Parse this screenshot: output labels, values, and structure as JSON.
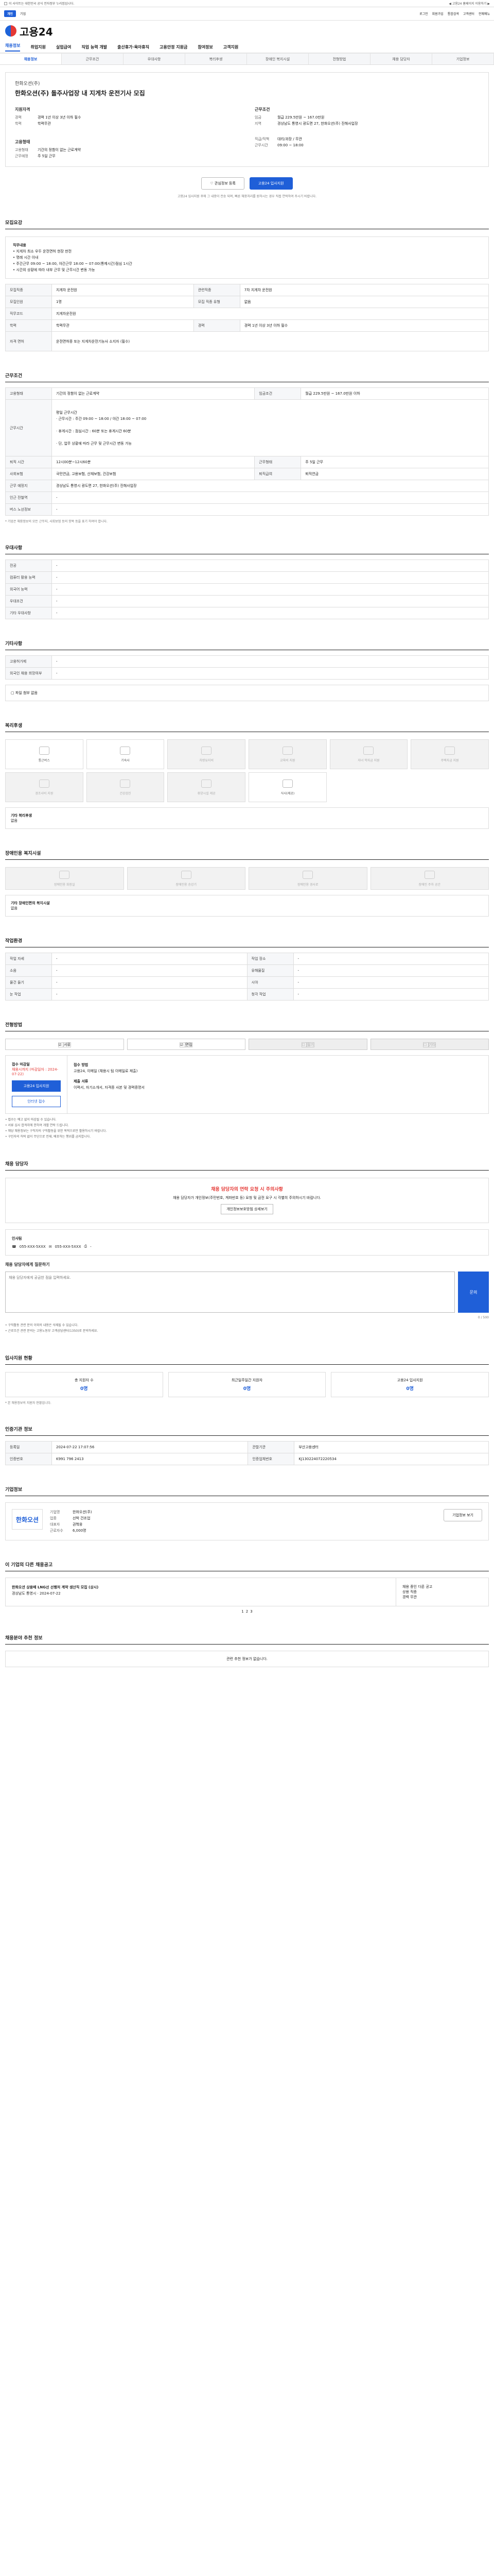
{
  "topbar": {
    "noti": "이 사이트는 대한민국 공식 전자정부 누리집입니다.",
    "right": "◀ 고용24 홈페이지 이용하기 ▶"
  },
  "topnav": {
    "left": [
      "개인",
      "기업"
    ],
    "right": [
      "로그인",
      "회원가입",
      "통합검색",
      "고객센터",
      "전체메뉴"
    ]
  },
  "logo": "고용24",
  "gnb": [
    "채용정보",
    "취업지원",
    "실업급여",
    "직업 능력 개발",
    "출산휴가·육아휴직",
    "고용안정 지원금",
    "참여정보",
    "고객지원"
  ],
  "subtabs": [
    "채용정보",
    "근무조건",
    "우대사항",
    "복리후생",
    "장애인 복지시설",
    "전형방법",
    "채용 담당자",
    "기업정보"
  ],
  "header": {
    "company": "한화오션(주)",
    "title": "한화오션(주) 돌주사업장 내 지게차 운전기사 모집",
    "left": {
      "h1": "지원자격",
      "r1": [
        [
          "경력",
          "경력 1년 이상 3년 이하 필수"
        ],
        [
          "학력",
          "학력무관"
        ]
      ],
      "h2": "고용형태",
      "r2": [
        [
          "고용형태",
          "기간의 정함이 없는 근로계약"
        ],
        [
          "근무예정",
          "주 5일 근무"
        ]
      ]
    },
    "right": {
      "h1": "근무조건",
      "r1": [
        [
          "임금",
          "월급 229.5만원 ~ 167.0만원"
        ],
        [
          "지역",
          "경상남도 통영시 광도면 27, 한화오션(주) 진해사업장"
        ]
      ],
      "r2": [
        [
          "직급/직책",
          "대리/과장",
          "무관"
        ],
        [
          "근무시간",
          "09:00 ~ 18:00"
        ]
      ]
    }
  },
  "actions": {
    "scrap": "관심정보 등록",
    "apply": "고용24 입사지원"
  },
  "actions_note": "고용24 입사지원 후에 그 내용이 전송 되며, 빠른 채용처리를 원하시는 경우 직접 연락하여 주시기 바랍니다.",
  "recruit": {
    "title": "모집요강",
    "jobtitle": "직무내용",
    "duties": [
      "지게차 최소 우두 운전면허 현장 판전",
      "명례 시간 이내",
      "주간근무 09:00 ~ 18:00, 야간근무 18:00 ~ 07:00(통제시간)점심 1시간",
      "시간외 상황에 따라 내부 근무 및 근무시간 변동 가능"
    ],
    "rows": [
      [
        "모집직종",
        "지게차 운전원",
        "관련직종",
        "7차 지게차 운전원"
      ],
      [
        "모집인원",
        "1명",
        "모집 직종 유형",
        "없음"
      ],
      [
        "직무코드",
        "지게차운전원",
        null,
        null
      ],
      [
        "학력",
        "학력무관",
        "경력",
        "경력 1년 이상 3년 이하 필수"
      ],
      [
        "자격 면허",
        "운전면허증 또는 지게차운전기능사 소지자 (필수)",
        null,
        null
      ]
    ]
  },
  "work": {
    "title": "근무조건",
    "rows": [
      [
        "고용형태",
        "기간의 정함이 없는 근로계약",
        "임금조건",
        "월급 229.5만원 ~ 167.0만원 이하"
      ],
      [
        "근무시간",
        "평일 근무시간\n· 근무시간 : 주간 09:00 ~ 18:00 / 야간 18:00 ~ 07:00\n\n· 휴게시간 : 점심시간 : 60분 또는 휴게시간 60분\n\n· 단, 업무 상황에 따라 근무 및 근무시간 변동 가능",
        null,
        null
      ],
      [
        "퇴직 시간",
        "12시00분~12시60분",
        "근무형태",
        "주 5일 근무"
      ],
      [
        "사회보험",
        "국민연금, 고용보험, 산재보험, 건강보험",
        "퇴직급여",
        "퇴직연금"
      ],
      [
        "근무 예정지",
        "경상남도 통영시 광도면 27, 한화오션(주) 진해사업장",
        null,
        null
      ],
      [
        "인근 전철역",
        "-",
        null,
        null
      ],
      [
        "버스 노선정보",
        "-",
        null,
        null
      ]
    ],
    "note": "* 기업은 채용정보의 모든 근무지, 사회보험 등의 항목 등을 표기 하여야 합니다."
  },
  "prefer": {
    "title": "우대사항",
    "rows": [
      [
        "전공",
        "-"
      ],
      [
        "컴퓨터 활용 능력",
        "-"
      ],
      [
        "외국어 능력",
        "-"
      ],
      [
        "우대조건",
        "-"
      ],
      [
        "기타 우대사항",
        "-"
      ]
    ]
  },
  "other_cond": {
    "title": "기타사항",
    "rows": [
      [
        "고용허가제",
        "-"
      ],
      [
        "외국인 채용 희망여부",
        "-"
      ]
    ],
    "attach": "파일 첨부 없음"
  },
  "welfare": {
    "title": "복리후생",
    "items": [
      [
        "통근버스",
        true
      ],
      [
        "기숙사",
        true
      ],
      [
        "차량유지비",
        false
      ],
      [
        "교육비 지원",
        false
      ],
      [
        "자녀 학자금 지원",
        false
      ],
      [
        "주택자금 지원",
        false
      ],
      [
        "경조사비 지원",
        false
      ],
      [
        "건강검진",
        false
      ],
      [
        "휴양시설 제공",
        false
      ],
      [
        "식사(제공)",
        true
      ]
    ],
    "etc_h": "기타 복리후생",
    "etc": "없음"
  },
  "disab": {
    "title": "장애인용 복지시설",
    "items": [
      "장애인용 화장실",
      "장애인용 승강기",
      "장애인용 경사로",
      "장애인 주차 공간"
    ],
    "etc_h": "기타 장애인편의 복지시설",
    "etc": "없음"
  },
  "work_env": {
    "title": "작업환경",
    "rows": [
      [
        "작업 자세",
        "-",
        "작업 장소",
        "-"
      ],
      [
        "소음",
        "-",
        "유해물질",
        "-"
      ],
      [
        "물건 들기",
        "-",
        "시야",
        "-"
      ],
      [
        "눈 작업",
        "-",
        "청각 작업",
        "-"
      ]
    ]
  },
  "select": {
    "title": "전형방법",
    "steps": [
      "서류",
      "면접",
      "필기",
      "기타"
    ],
    "apply_h": "접수 마감일",
    "deadline": "채용시까지 (마감일자 : 2024-07-22)",
    "btn1": "고용24 입사지원",
    "btn2": "인터넷 접수",
    "method_h": "접수 방법",
    "methods": "고용24, 이메일 (채용시 팀 이메일로 제출)",
    "docs_h": "제출 서류",
    "docs": "이력서, 자기소개서, 자격증 사본 및 경력증명서",
    "notes": [
      "접수는 예고 없이 마감될 수 있습니다.",
      "서류 심사 합격자에 한하여 개별 연락 드립니다.",
      "해당 채용정보는 구직자의 구직활동을 위한 목적으로만 활용하시기 바랍니다.",
      "구인자의 허락 없이 무단으로 전재, 배포하는 행위를 금지합니다."
    ]
  },
  "contact": {
    "title": "채용 담당자",
    "alert_h": "채용 담당자의 연락 요청 시 주의사항",
    "alert": "채용 담당자가 개인정보(주민번호, 계좌번호 등) 요청 및 금전 요구 시 각별히 주의하시기 바랍니다.",
    "alert_btn": "개인정보보호방침 상세보기",
    "name": "인사팀",
    "phone": "055-XXX-5XXX",
    "email": "055-XXX-5XXX",
    "fax": "-",
    "inq_h": "채용 담당자에게 질문하기",
    "inq_placeholder": "채용 담당자에게 궁금한 점을 입력하세요.",
    "inq_btn": "문의",
    "inq_count": "0 / 500",
    "inq_notes": [
      "구직활동 관련 문의 이외의 내용은 삭제될 수 있습니다.",
      "근로조건 관련 문의는 고용노동부 고객상담센터(1350)로 문의하세요."
    ]
  },
  "stats": {
    "title": "입사지원 현황",
    "items": [
      [
        "총 지원자 수",
        "0명"
      ],
      [
        "최근일주일간 지원자",
        "0명"
      ],
      [
        "고용24 입사지원",
        "0명"
      ]
    ],
    "note": "* 본 채용정보의 지원자 현황입니다."
  },
  "mgmt": {
    "title": "인증기관 정보",
    "rows": [
      [
        "등록일",
        "2024-07-22 17:07:56",
        "관할기관",
        "부산고용센터"
      ],
      [
        "인증번호",
        "K991 796 2413",
        "인증업체번호",
        "KJ130224072220534"
      ]
    ]
  },
  "company_info": {
    "title": "기업정보",
    "name": "한화오션",
    "rows": [
      [
        "기업명",
        "한화오션(주)"
      ],
      [
        "업종",
        "선박 건조업"
      ],
      [
        "대표자",
        "권혁웅"
      ],
      [
        "근로자수",
        "6,000명"
      ]
    ],
    "btn": "기업정보 보기"
  },
  "other_jobs": {
    "title": "이 기업의 다른 채용공고",
    "job": "한화오션 상용배 LNG선 선행처 계약 생산직 모집 (상시)",
    "meta": "경상남도 통영시 · 2024-07-22",
    "side": [
      "채용 중인 다른 공고",
      "상용 직종",
      "경력 무관"
    ],
    "pager": [
      "1",
      "2",
      "3"
    ]
  },
  "faq": {
    "title": "채용분야 추천 정보",
    "body": "관련 추천 정보가 없습니다."
  }
}
